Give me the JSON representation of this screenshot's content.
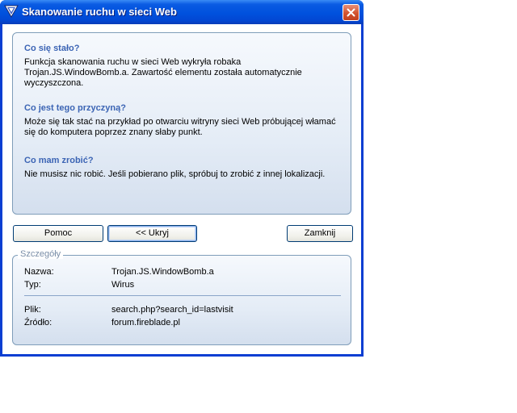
{
  "window": {
    "title": "Skanowanie ruchu w sieci Web"
  },
  "info": {
    "what_happened": {
      "heading": "Co się stało?",
      "text": "Funkcja skanowania ruchu w sieci Web wykryła robaka Trojan.JS.WindowBomb.a. Zawartość elementu została automatycznie wyczyszczona."
    },
    "cause": {
      "heading": "Co jest tego przyczyną?",
      "text": "Może się tak stać na przykład po otwarciu witryny sieci Web próbującej włamać się do komputera poprzez znany słaby punkt."
    },
    "action": {
      "heading": "Co mam zrobić?",
      "text": "Nie musisz nic robić. Jeśli pobierano plik, spróbuj to zrobić z innej lokalizacji."
    }
  },
  "buttons": {
    "help": "Pomoc",
    "hide": "<< Ukryj",
    "close": "Zamknij"
  },
  "details": {
    "legend": "Szczegóły",
    "name_label": "Nazwa:",
    "name_value": "Trojan.JS.WindowBomb.a",
    "type_label": "Typ:",
    "type_value": "Wirus",
    "file_label": "Plik:",
    "file_value": "search.php?search_id=lastvisit",
    "source_label": "Źródło:",
    "source_value": "forum.fireblade.pl"
  },
  "icons": {
    "app": "antivirus-logo-icon",
    "close": "close-icon"
  },
  "colors": {
    "titlebar": "#0051dd",
    "heading": "#3b64b4",
    "close_button": "#d2532f"
  }
}
